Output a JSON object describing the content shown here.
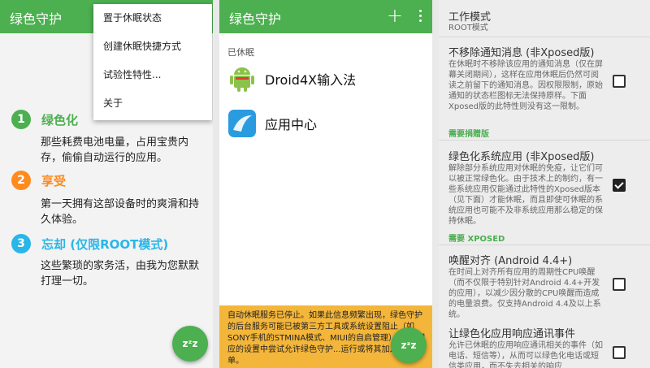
{
  "panel1": {
    "appbar_title": "绿色守护",
    "menu_items": [
      "置于休眠状态",
      "创建休眠快捷方式",
      "试验性特性...",
      "关于"
    ],
    "steps": [
      {
        "number": "1",
        "heading": "绿色化",
        "color": "#4caf50",
        "desc": "那些耗费电池电量，占用宝贵内存，偷偷自动运行的应用。"
      },
      {
        "number": "2",
        "heading": "享受",
        "color": "#ff8a1e",
        "desc": "第一天拥有这部设备时的爽滑和持久体验。"
      },
      {
        "number": "3",
        "heading": "忘却 (仅限ROOT模式)",
        "color": "#29b6e8",
        "desc": "这些繁琐的家务活，由我为您默默打理一切。"
      }
    ],
    "fab_label": "zᶻz"
  },
  "panel2": {
    "appbar_title": "绿色守护",
    "plus_icon": "+",
    "section_label": "已休眠",
    "apps": [
      {
        "name": "Droid4X输入法",
        "icon": "android-icon"
      },
      {
        "name": "应用中心",
        "icon": "app-center-icon"
      }
    ],
    "notice": "自动休眠服务已停止。如果此信息频繁出现，绿色守护的后台服务可能已被第三方工具或系统设置阻止（如SONY手机的STMINA模式、MIUI的自启管理），请在相应的设置中尝试允许绿色守护...运行或将其加入白名单。",
    "fab_label": "zᶻz"
  },
  "panel3": {
    "work_mode_title": "工作模式",
    "work_mode_value": "ROOT模式",
    "prefs": [
      {
        "title": "不移除通知消息 (非Xposed版)",
        "summary": "在休眠时不移除该应用的通知消息（仅在屏幕关闭期间），这样在应用休眠后仍然可阅读之前留下的通知消息。因权限限制，原始通知的状态栏图标无法保持原样。下面Xposed版的此特性则没有这一限制。",
        "checked": false
      },
      {
        "title": "绿色化系统应用 (非Xposed版)",
        "summary": "解除部分系统应用对休眠的免疫，让它们可以被正常绿色化。由于技术上的制约，有一些系统应用仅能通过此特性的Xposed版本（见下面）才能休眠，而且即使可休眠的系统应用也可能不及非系统应用那么稳定的保持休眠。",
        "checked": true
      },
      {
        "title": "唤醒对齐 (Android 4.4+)",
        "summary": "在时间上对齐所有应用的周期性CPU唤醒（而不仅限于特别针对Android 4.4+开发的应用），以减少因分散的CPU唤醒而造成的电量浪费。仅支持Android 4.4及以上系统。",
        "checked": false
      },
      {
        "title": "让绿色化应用响应通讯事件",
        "summary": "允许已休眠的应用响应通讯相关的事件（如电话、短信等），从而可以绿色化电话或短信类应用，而不失去相关的响应",
        "checked": false
      }
    ],
    "categories": [
      "需要捐赠版",
      "需要 XPOSED"
    ],
    "colors": {
      "accent": "#4caf50"
    }
  }
}
